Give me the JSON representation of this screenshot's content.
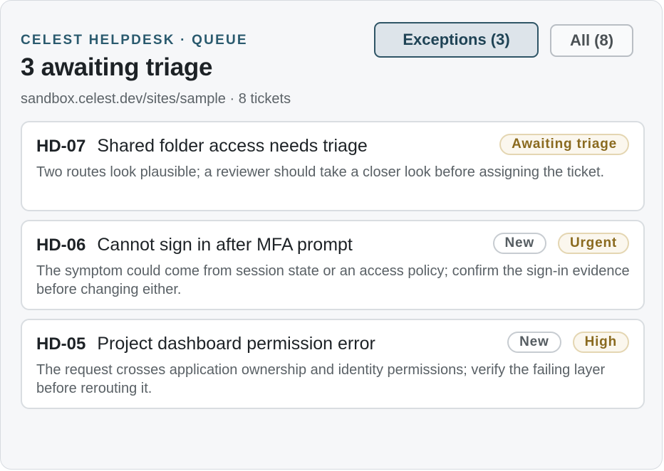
{
  "header": {
    "eyebrow": "CELEST HELPDESK · QUEUE",
    "title": "3 awaiting triage",
    "subline": "sandbox.celest.dev/sites/sample · 8 tickets"
  },
  "filters": {
    "exceptions_label": "Exceptions (3)",
    "all_label": "All (8)",
    "active": "Exceptions (3)"
  },
  "tickets": [
    {
      "id": "HD-07",
      "title": "Shared folder access needs triage",
      "description": "Two routes look plausible; a reviewer should take a closer look before assigning the ticket.",
      "badges": [
        "Awaiting triage"
      ]
    },
    {
      "id": "HD-06",
      "title": "Cannot sign in after MFA prompt",
      "description": "The symptom could come from session state or an access policy; confirm the sign-in evidence before changing either.",
      "badges": [
        "New",
        "Urgent"
      ]
    },
    {
      "id": "HD-05",
      "title": "Project dashboard permission error",
      "description": "The request crosses application ownership and identity permissions; verify the failing layer before rerouting it.",
      "badges": [
        "New",
        "High"
      ]
    }
  ],
  "colors": {
    "accent": "#2a5a6e",
    "warn_badge_text": "#8a6a1f",
    "panel_background": "#f6f7f9"
  }
}
